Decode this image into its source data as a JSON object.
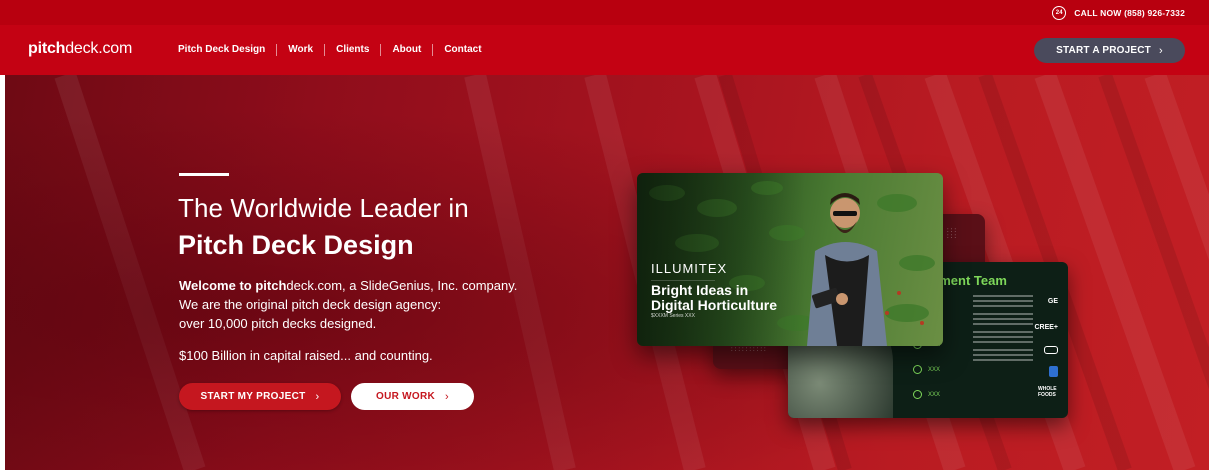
{
  "topbar": {
    "phone_badge": "24",
    "call_text": "CALL NOW (858) 926-7332"
  },
  "brand": {
    "logo_bold": "pitch",
    "logo_rest": "deck.com"
  },
  "nav": {
    "items": [
      "Pitch Deck Design",
      "Work",
      "Clients",
      "About",
      "Contact"
    ],
    "cta": "START A PROJECT",
    "cta_chevron": "›"
  },
  "hero": {
    "heading_line1": "The Worldwide Leader in",
    "heading_line2": "Pitch Deck Design",
    "welcome_bold": "Welcome to pitch",
    "welcome_rest": "deck.com, a SlideGenius, Inc. company.",
    "line2": "We are the original pitch deck design agency:",
    "line3": "over 10,000 pitch decks designed.",
    "capital": "$100 Billion in capital raised... and counting.",
    "btn_primary": "START MY PROJECT",
    "btn_secondary": "OUR WORK",
    "chevron": "›"
  },
  "slides": {
    "main": {
      "brand": "ILLUMITEX",
      "title_line1": "Bright Ideas in",
      "title_line2": "Digital Horticulture",
      "series": "$XXXM  Series XXX"
    },
    "team": {
      "title": "ement Team",
      "logos": [
        "GE",
        "CREE+",
        "",
        "",
        "WHOLE FOODS"
      ],
      "people": [
        "XXX",
        "XXX",
        "XXX"
      ]
    }
  },
  "colors": {
    "header": "#c40213",
    "topbar": "#b8000f",
    "cta": "#4a4a5c",
    "accent": "#c5171f",
    "team_green": "#7ed85a"
  }
}
